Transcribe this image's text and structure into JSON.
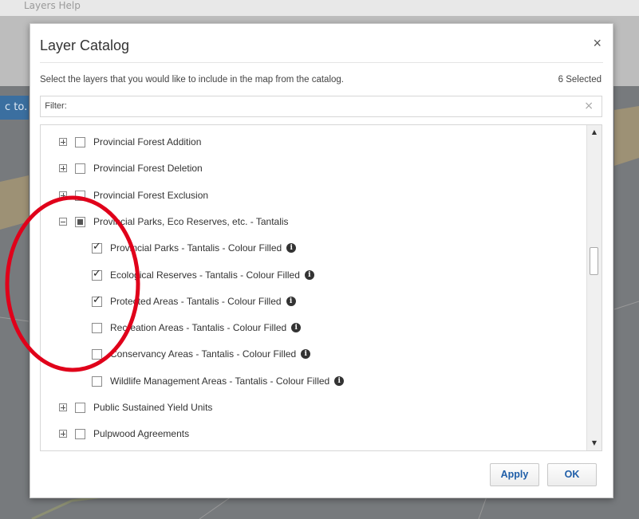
{
  "background": {
    "menu_text": "Layers    Help",
    "banner_text": "c to."
  },
  "dialog": {
    "title": "Layer Catalog",
    "close_label": "×",
    "description": "Select the layers that you would like to include in the map from the catalog.",
    "selected_count": "6 Selected",
    "filter_label": "Filter:",
    "filter_value": "",
    "filter_clear": "×",
    "apply_label": "Apply",
    "ok_label": "OK"
  },
  "layers": [
    {
      "label": "Provincial Forest Addition",
      "expander": "plus",
      "checked": false,
      "level": 0,
      "info": false
    },
    {
      "label": "Provincial Forest Deletion",
      "expander": "plus",
      "checked": false,
      "level": 0,
      "info": false
    },
    {
      "label": "Provincial Forest Exclusion",
      "expander": "plus",
      "checked": false,
      "level": 0,
      "info": false
    },
    {
      "label": "Provincial Parks, Eco Reserves, etc. - Tantalis",
      "expander": "minus",
      "checked": "partial",
      "level": 0,
      "info": false
    },
    {
      "label": "Provincial Parks - Tantalis - Colour Filled",
      "expander": null,
      "checked": true,
      "level": 1,
      "info": true
    },
    {
      "label": "Ecological Reserves - Tantalis - Colour Filled",
      "expander": null,
      "checked": true,
      "level": 1,
      "info": true
    },
    {
      "label": "Protected Areas - Tantalis - Colour Filled",
      "expander": null,
      "checked": true,
      "level": 1,
      "info": true
    },
    {
      "label": "Recreation Areas - Tantalis - Colour Filled",
      "expander": null,
      "checked": false,
      "level": 1,
      "info": true
    },
    {
      "label": "Conservancy Areas - Tantalis - Colour Filled",
      "expander": null,
      "checked": false,
      "level": 1,
      "info": true
    },
    {
      "label": "Wildlife Management Areas - Tantalis - Colour Filled",
      "expander": null,
      "checked": false,
      "level": 1,
      "info": true
    },
    {
      "label": "Public Sustained Yield Units",
      "expander": "plus",
      "checked": false,
      "level": 0,
      "info": false
    },
    {
      "label": "Pulpwood Agreements",
      "expander": "plus",
      "checked": false,
      "level": 0,
      "info": false
    }
  ],
  "icons": {
    "info": "info-icon",
    "close": "close-icon",
    "scroll_up": "scroll-up-icon",
    "scroll_down": "scroll-down-icon"
  },
  "colors": {
    "accent": "#1f5ea8",
    "annotation": "#e0001a",
    "banner": "#3b6fa0"
  }
}
